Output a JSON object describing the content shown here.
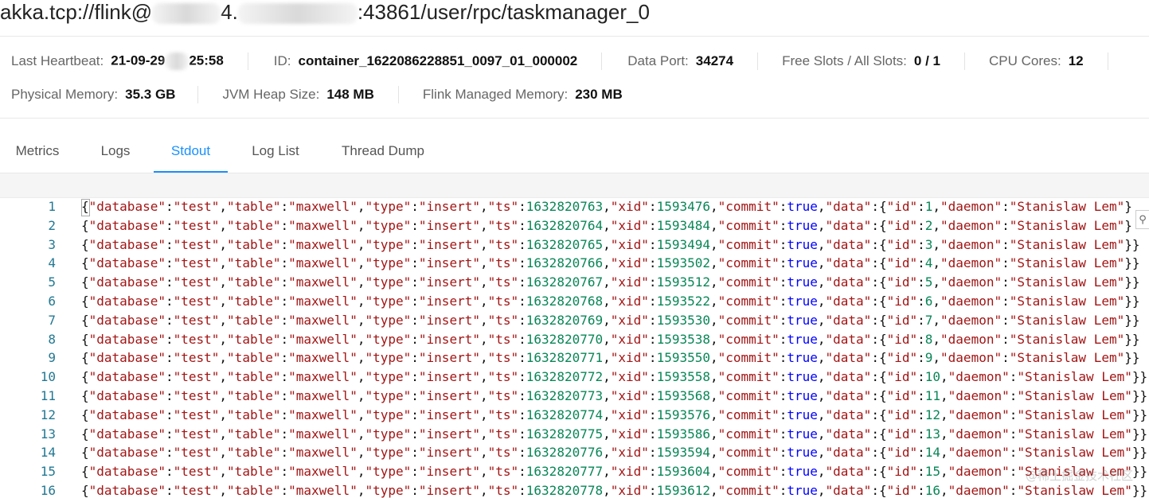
{
  "header": {
    "title_prefix": "akka.tcp://flink@",
    "title_mid": "4.",
    "title_suffix": ":43861/user/rpc/taskmanager_0"
  },
  "info": {
    "last_heartbeat_label": "Last Heartbeat:",
    "last_heartbeat_value_a": "21-09-29",
    "last_heartbeat_value_b": "25:58",
    "id_label": "ID:",
    "id_value": "container_1622086228851_0097_01_000002",
    "data_port_label": "Data Port:",
    "data_port_value": "34274",
    "free_slots_label": "Free Slots / All Slots:",
    "free_slots_value": "0 / 1",
    "cpu_cores_label": "CPU Cores:",
    "cpu_cores_value": "12",
    "physical_memory_label": "Physical Memory:",
    "physical_memory_value": "35.3 GB",
    "jvm_heap_label": "JVM Heap Size:",
    "jvm_heap_value": "148 MB",
    "flink_managed_label": "Flink Managed Memory:",
    "flink_managed_value": "230 MB"
  },
  "tabs": [
    {
      "label": "Metrics"
    },
    {
      "label": "Logs"
    },
    {
      "label": "Stdout"
    },
    {
      "label": "Log List"
    },
    {
      "label": "Thread Dump"
    }
  ],
  "active_tab": "Stdout",
  "stdout": {
    "lines": [
      {
        "n": "1",
        "ts": "1632820763",
        "xid": "1593476",
        "id": "1",
        "end": "}"
      },
      {
        "n": "2",
        "ts": "1632820764",
        "xid": "1593484",
        "id": "2",
        "end": "}"
      },
      {
        "n": "3",
        "ts": "1632820765",
        "xid": "1593494",
        "id": "3",
        "end": "}}"
      },
      {
        "n": "4",
        "ts": "1632820766",
        "xid": "1593502",
        "id": "4",
        "end": "}}"
      },
      {
        "n": "5",
        "ts": "1632820767",
        "xid": "1593512",
        "id": "5",
        "end": "}}"
      },
      {
        "n": "6",
        "ts": "1632820768",
        "xid": "1593522",
        "id": "6",
        "end": "}}"
      },
      {
        "n": "7",
        "ts": "1632820769",
        "xid": "1593530",
        "id": "7",
        "end": "}}"
      },
      {
        "n": "8",
        "ts": "1632820770",
        "xid": "1593538",
        "id": "8",
        "end": "}}"
      },
      {
        "n": "9",
        "ts": "1632820771",
        "xid": "1593550",
        "id": "9",
        "end": "}}"
      },
      {
        "n": "10",
        "ts": "1632820772",
        "xid": "1593558",
        "id": "10",
        "end": "}}"
      },
      {
        "n": "11",
        "ts": "1632820773",
        "xid": "1593568",
        "id": "11",
        "end": "}}"
      },
      {
        "n": "12",
        "ts": "1632820774",
        "xid": "1593576",
        "id": "12",
        "end": "}}"
      },
      {
        "n": "13",
        "ts": "1632820775",
        "xid": "1593586",
        "id": "13",
        "end": "}}"
      },
      {
        "n": "14",
        "ts": "1632820776",
        "xid": "1593594",
        "id": "14",
        "end": "}}"
      },
      {
        "n": "15",
        "ts": "1632820777",
        "xid": "1593604",
        "id": "15",
        "end": "}}"
      },
      {
        "n": "16",
        "ts": "1632820778",
        "xid": "1593612",
        "id": "16",
        "end": "}}"
      }
    ],
    "db_key": "\"database\"",
    "db_val": "\"test\"",
    "table_key": "\"table\"",
    "table_val": "\"maxwell\"",
    "type_key": "\"type\"",
    "type_val": "\"insert\"",
    "ts_key": "\"ts\"",
    "xid_key": "\"xid\"",
    "commit_key": "\"commit\"",
    "commit_val": "true",
    "data_key": "\"data\"",
    "id_key": "\"id\"",
    "daemon_key": "\"daemon\"",
    "daemon_val": "\"Stanislaw Lem\""
  },
  "watermark": "@稀土掘金技术社区"
}
